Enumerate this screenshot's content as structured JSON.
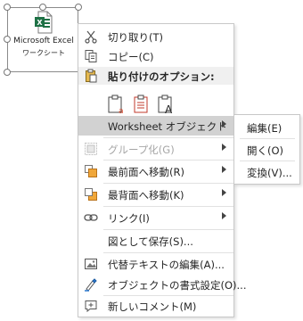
{
  "object": {
    "label_line1": "Microsoft Excel",
    "label_line2": "ワークシート",
    "icon": "excel-icon"
  },
  "menu": {
    "items": {
      "cut": {
        "label": "切り取り(T)",
        "icon": "scissors-icon"
      },
      "copy": {
        "label": "コピー(C)",
        "icon": "copy-icon"
      },
      "paste_header": {
        "label": "貼り付けのオプション:",
        "icon": "clipboard-icon"
      },
      "worksheet_object": {
        "label": "Worksheet オブジェクト"
      },
      "group": {
        "label": "グループ化(G)",
        "icon": "group-icon",
        "disabled": true
      },
      "bring_front": {
        "label": "最前面へ移動(R)",
        "icon": "bring-to-front-icon"
      },
      "send_back": {
        "label": "最背面へ移動(K)",
        "icon": "send-to-back-icon"
      },
      "link": {
        "label": "リンク(I)",
        "icon": "link-icon"
      },
      "save_as_picture": {
        "label": "図として保存(S)..."
      },
      "alt_text": {
        "label": "代替テキストの編集(A)...",
        "icon": "alt-text-icon"
      },
      "format_object": {
        "label": "オブジェクトの書式設定(O)...",
        "icon": "format-object-icon"
      },
      "new_comment": {
        "label": "新しいコメント(M)",
        "icon": "new-comment-icon"
      }
    }
  },
  "submenu": {
    "items": [
      {
        "label": "編集(E)"
      },
      {
        "label": "開く(O)"
      },
      {
        "label": "変換(V)..."
      }
    ]
  },
  "colors": {
    "highlight": "#d2d2d2",
    "excel_green": "#1e7145",
    "disabled_text": "#a6a6a6"
  }
}
